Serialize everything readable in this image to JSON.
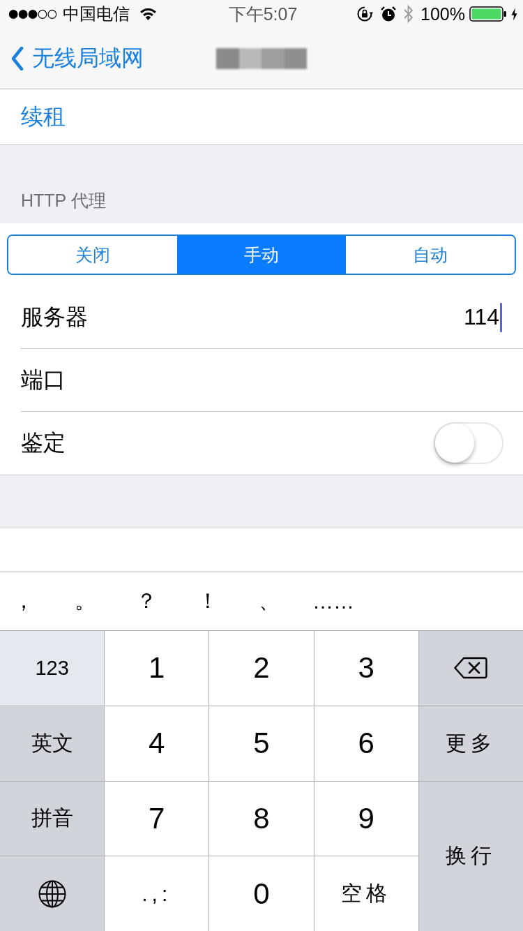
{
  "status_bar": {
    "carrier": "中国电信",
    "time": "下午5:07",
    "battery": "100%"
  },
  "nav_bar": {
    "back": "无线局域网"
  },
  "renew": {
    "label": "续租"
  },
  "http_proxy": {
    "header": "HTTP 代理",
    "modes": [
      {
        "label": "关闭",
        "selected": false
      },
      {
        "label": "手动",
        "selected": true
      },
      {
        "label": "自动",
        "selected": false
      }
    ],
    "rows": [
      {
        "kind": "input",
        "label": "服务器",
        "value": "114",
        "focused": true
      },
      {
        "kind": "input",
        "label": "端口",
        "focused": false
      },
      {
        "kind": "toggle",
        "label": "鉴定",
        "on": false
      }
    ]
  },
  "keyboard": {
    "candidates": [
      "，",
      "。",
      "？",
      "！",
      "、",
      "……"
    ],
    "left_keys": [
      {
        "kind": "mode",
        "label": "123",
        "selected": true
      },
      {
        "kind": "mode",
        "label": "英文",
        "selected": false
      },
      {
        "kind": "mode",
        "label": "拼音",
        "selected": false
      },
      {
        "kind": "globe",
        "selected": false
      }
    ],
    "center_keys": [
      {
        "kind": "digit",
        "label": "1"
      },
      {
        "kind": "digit",
        "label": "2"
      },
      {
        "kind": "digit",
        "label": "3"
      },
      {
        "kind": "digit",
        "label": "4"
      },
      {
        "kind": "digit",
        "label": "5"
      },
      {
        "kind": "digit",
        "label": "6"
      },
      {
        "kind": "digit",
        "label": "7"
      },
      {
        "kind": "digit",
        "label": "8"
      },
      {
        "kind": "digit",
        "label": "9"
      },
      {
        "kind": "symbol",
        "label": ".,:"
      },
      {
        "kind": "digit",
        "label": "0"
      },
      {
        "kind": "symbol",
        "label": "空格"
      }
    ],
    "right_keys": [
      {
        "kind": "delete"
      },
      {
        "kind": "text",
        "label": "更多"
      },
      {
        "kind": "return",
        "label": "换行"
      }
    ]
  }
}
